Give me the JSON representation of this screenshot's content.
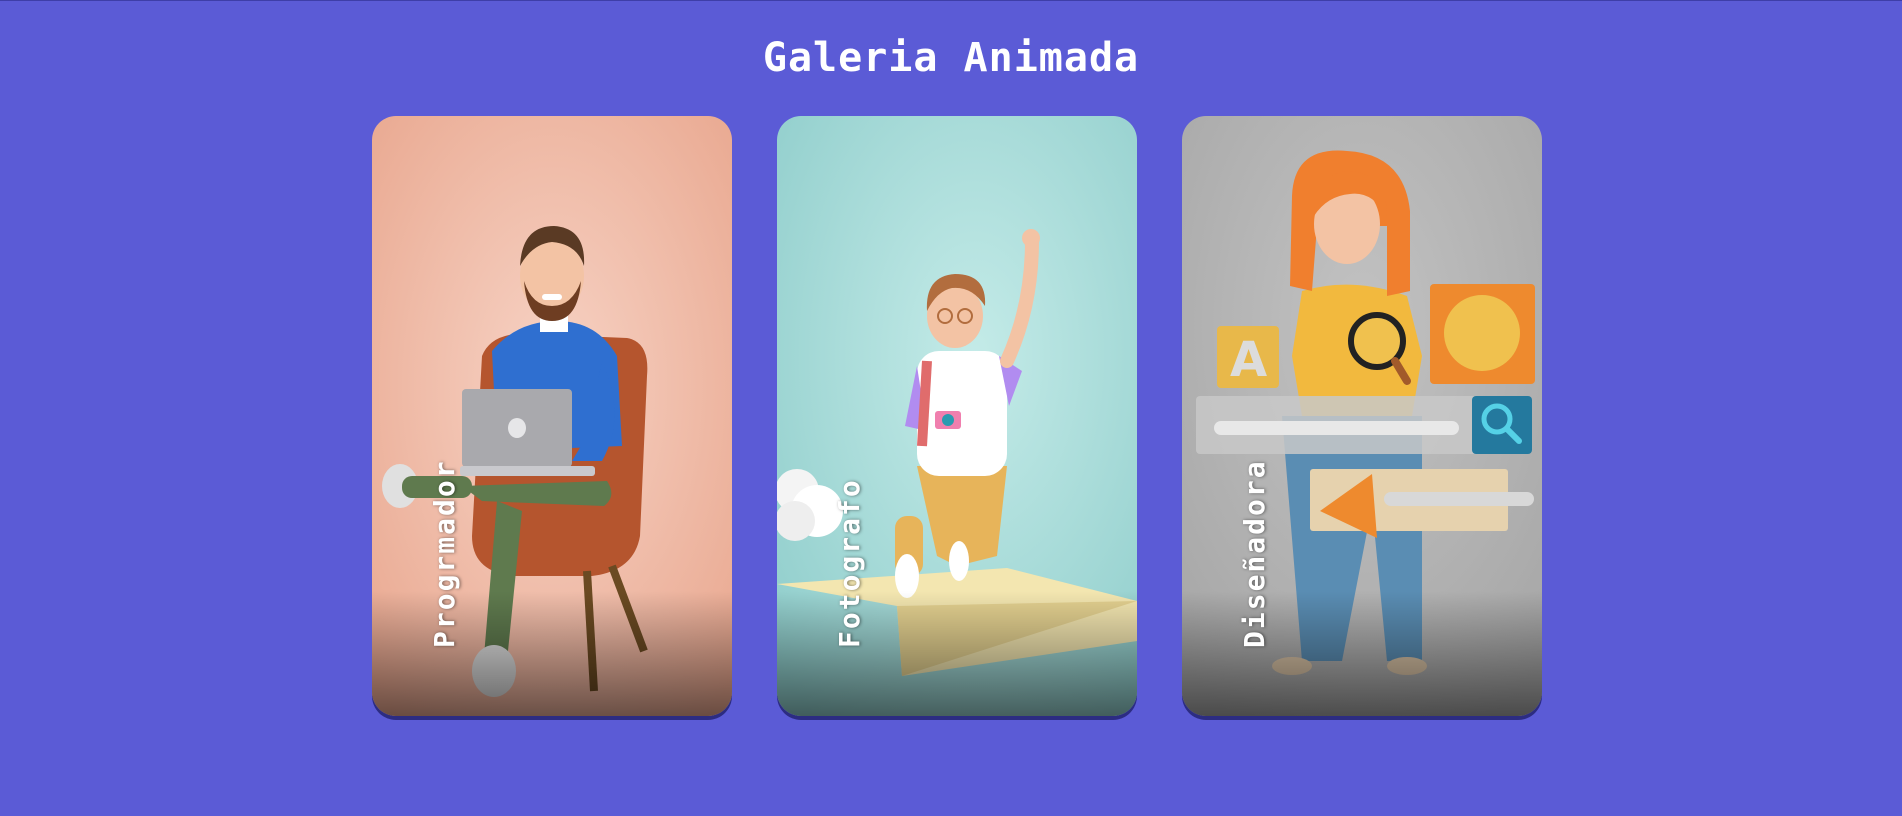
{
  "page": {
    "title": "Galeria Animada"
  },
  "colors": {
    "background": "#5b5bd6",
    "card_programmer_bg": "#f0b9a6",
    "card_photographer_bg": "#a8dbd9",
    "card_designer_bg": "#b3b3b3"
  },
  "gallery": {
    "cards": [
      {
        "label": "Progrmador",
        "illustration": "man-with-laptop-on-chair"
      },
      {
        "label": "Fotografo",
        "illustration": "boy-with-camera-on-paper-plane"
      },
      {
        "label": "Diseñadora",
        "illustration": "woman-with-magnifier-and-shapes"
      }
    ]
  }
}
